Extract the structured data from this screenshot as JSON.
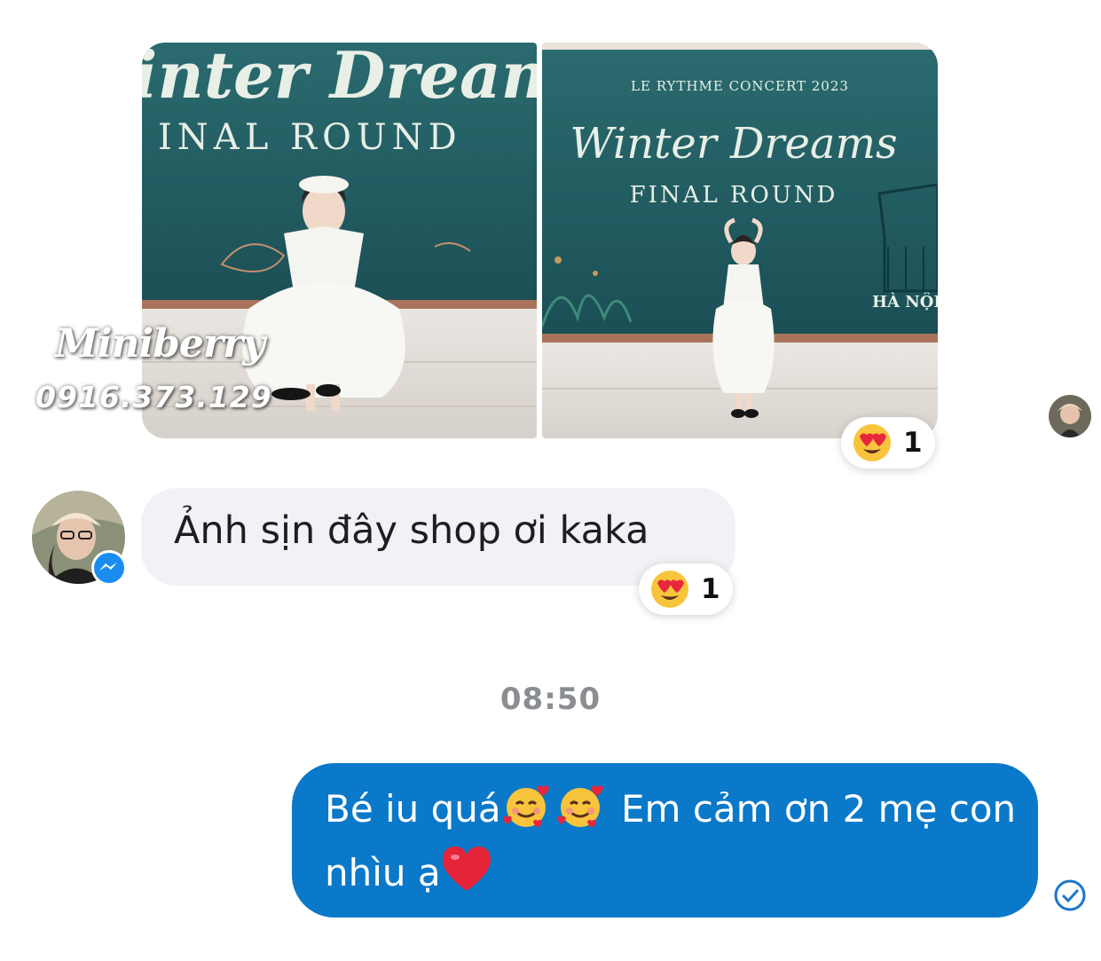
{
  "photos": {
    "left": {
      "backdrop_title": "inter Dream",
      "backdrop_subtitle": "INAL ROUND"
    },
    "right": {
      "backdrop_header": "LE RYTHME CONCERT 2023",
      "backdrop_title": "Winter Dreams",
      "backdrop_subtitle": "FINAL ROUND",
      "backdrop_location": "HÀ NỘI,"
    }
  },
  "watermark": {
    "brand": "Miniberry",
    "phone": "0916.373.129"
  },
  "photo_reaction": {
    "emoji": "heart-eyes-emoji",
    "count": "1"
  },
  "incoming_message": {
    "text": "Ảnh sịn đây shop ơi kaka",
    "reaction": {
      "emoji": "heart-eyes-emoji",
      "count": "1"
    }
  },
  "timestamp": "08:50",
  "outgoing_message": {
    "part1": "Bé iu quá",
    "part2": " Em cảm ơn 2 mẹ con nhìu ạ",
    "status": "sent-check-icon"
  },
  "colors": {
    "outgoing_bubble": "#0a79c9",
    "incoming_bubble": "#f1f2f5",
    "timestamp": "#8a8d91",
    "backdrop": "#1f5a5f"
  }
}
